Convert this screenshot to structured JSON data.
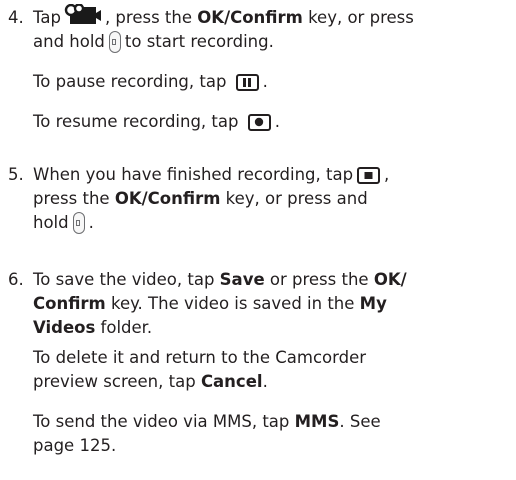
{
  "step4": {
    "number": "4.",
    "tap": "Tap",
    "after_icon": ", press the",
    "ok_confirm": "OK/Confirm",
    "key_or": "key, or press",
    "and_hold": "and hold",
    "to_start": "to start recording.",
    "pause": "To pause recording, tap",
    "resume": "To resume recording, tap",
    "period": "."
  },
  "step5": {
    "number": "5.",
    "text1": "When you have finished recording, tap",
    "comma": ",",
    "press_the": "press the",
    "ok_confirm": "OK/Confirm",
    "key_or_press_and": "key, or press and",
    "hold": "hold",
    "period": "."
  },
  "step6": {
    "number": "6.",
    "to_save": "To save the video, tap",
    "save": "Save",
    "or_press_the": "or press the",
    "ok": "OK/",
    "confirm": "Confirm",
    "key_saved": "key. The video is saved in the",
    "my": "My",
    "videos": "Videos",
    "folder": "folder.",
    "delete_1": "To delete it and return to the Camcorder",
    "delete_2": "preview screen, tap",
    "cancel": "Cancel",
    "mms_1": "To send the video via MMS, tap",
    "mms": "MMS",
    "see": ". See",
    "page": "page 125.",
    "period": "."
  },
  "icons": {
    "video": "video-camera-icon",
    "hold_key": "side-key-icon",
    "pause": "pause-icon",
    "record": "record-icon",
    "stop": "stop-icon"
  }
}
